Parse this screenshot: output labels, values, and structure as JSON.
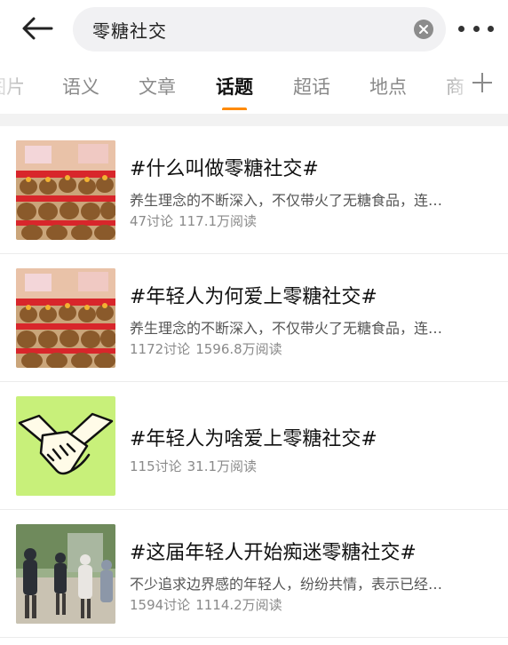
{
  "header": {
    "search_value": "零糖社交"
  },
  "tabs": [
    {
      "label": "图片"
    },
    {
      "label": "语义"
    },
    {
      "label": "文章"
    },
    {
      "label": "话题",
      "active": true
    },
    {
      "label": "超话"
    },
    {
      "label": "地点"
    },
    {
      "label": "商"
    }
  ],
  "accent_color": "#ff8a00",
  "topics": [
    {
      "title": "#什么叫做零糖社交#",
      "desc": "养生理念的不断深入，不仅带火了无糖食品，连…",
      "discussions": "47讨论",
      "reads": "117.1万阅读",
      "thumb": "capybara-plush-photo"
    },
    {
      "title": "#年轻人为何爱上零糖社交#",
      "desc": "养生理念的不断深入，不仅带火了无糖食品，连…",
      "discussions": "1172讨论",
      "reads": "1596.8万阅读",
      "thumb": "capybara-plush-photo"
    },
    {
      "title": "#年轻人为啥爱上零糖社交#",
      "desc": "",
      "discussions": "115讨论",
      "reads": "31.1万阅读",
      "thumb": "handshake-illustration"
    },
    {
      "title": "#这届年轻人开始痴迷零糖社交#",
      "desc": "不少追求边界感的年轻人，纷纷共情，表示已经…",
      "discussions": "1594讨论",
      "reads": "1114.2万阅读",
      "thumb": "people-street-photo"
    }
  ]
}
